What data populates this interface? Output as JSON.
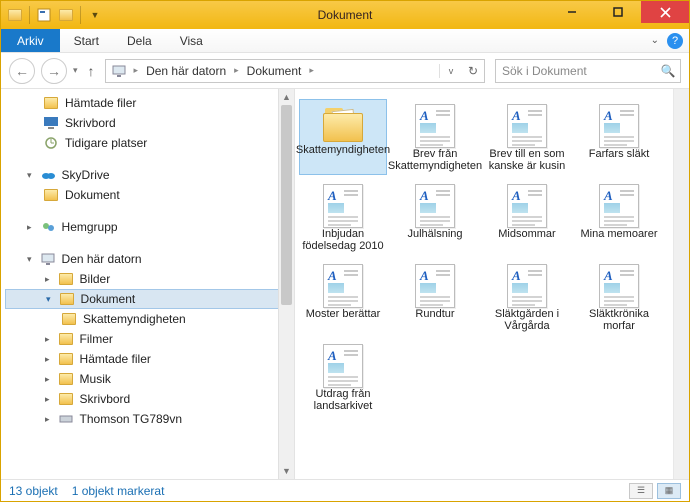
{
  "window": {
    "title": "Dokument"
  },
  "menubar": {
    "arkiv": "Arkiv",
    "items": [
      "Start",
      "Dela",
      "Visa"
    ]
  },
  "breadcrumb": {
    "segments": [
      "Den här datorn",
      "Dokument"
    ]
  },
  "search": {
    "placeholder": "Sök i Dokument"
  },
  "tree": {
    "group1": [
      {
        "label": "Hämtade filer",
        "icon": "folder"
      },
      {
        "label": "Skrivbord",
        "icon": "desktop"
      },
      {
        "label": "Tidigare platser",
        "icon": "recent"
      }
    ],
    "skydrive": {
      "label": "SkyDrive",
      "child": "Dokument"
    },
    "hemgrupp": "Hemgrupp",
    "thispc": {
      "label": "Den här datorn",
      "children_before": [
        "Bilder"
      ],
      "selected": "Dokument",
      "sub": "Skattemyndigheten",
      "children_after": [
        "Filmer",
        "Hämtade filer",
        "Musik",
        "Skrivbord",
        "Thomson TG789vn"
      ]
    }
  },
  "items": [
    {
      "label": "Skattemyndigheten",
      "type": "folder",
      "selected": true
    },
    {
      "label": "Brev från Skattemyndigheten",
      "type": "doc"
    },
    {
      "label": "Brev till en som kanske är kusin",
      "type": "doc"
    },
    {
      "label": "Farfars släkt",
      "type": "doc"
    },
    {
      "label": "Inbjudan födelsedag 2010",
      "type": "doc"
    },
    {
      "label": "Julhälsning",
      "type": "doc"
    },
    {
      "label": "Midsommar",
      "type": "doc"
    },
    {
      "label": "Mina memoarer",
      "type": "doc"
    },
    {
      "label": "Moster berättar",
      "type": "doc"
    },
    {
      "label": "Rundtur",
      "type": "doc"
    },
    {
      "label": "Släktgården i Vårgårda",
      "type": "doc"
    },
    {
      "label": "Släktkrönika morfar",
      "type": "doc"
    },
    {
      "label": "Utdrag från landsarkivet",
      "type": "doc"
    }
  ],
  "status": {
    "count": "13 objekt",
    "selected": "1 objekt markerat"
  }
}
